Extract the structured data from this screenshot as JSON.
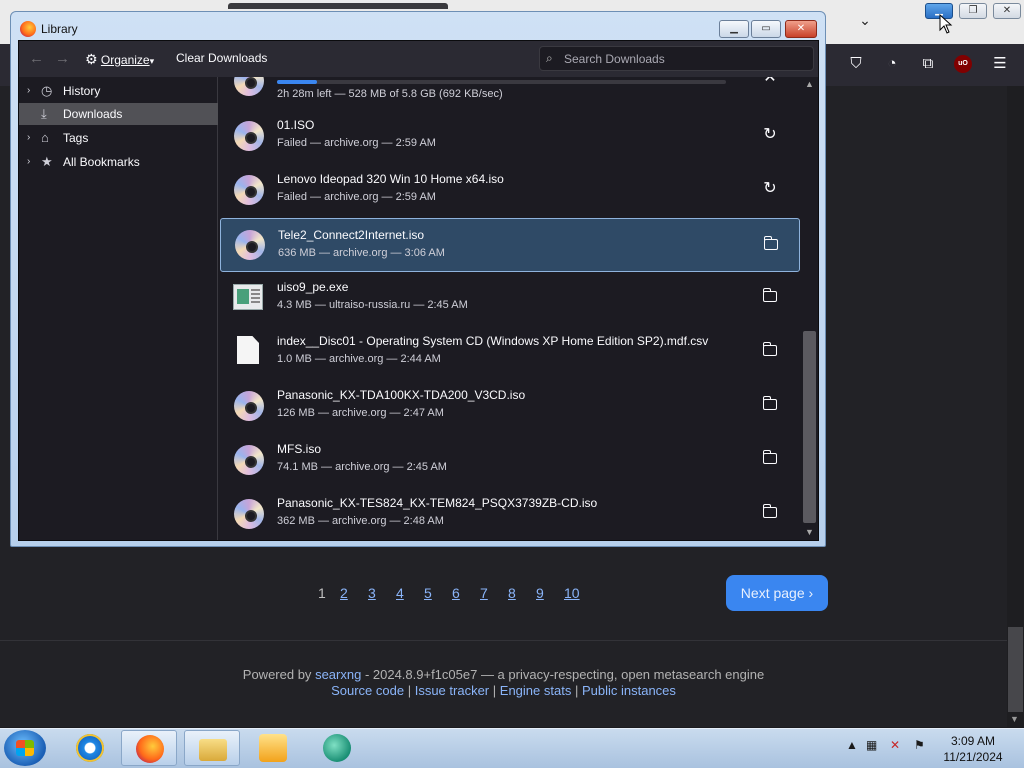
{
  "library": {
    "title": "Library",
    "toolbar": {
      "organize_label": "Organize",
      "organize_caret": "▾",
      "clear_downloads_label": "Clear Downloads",
      "search_placeholder": "Search Downloads"
    },
    "sidebar": [
      {
        "label": "History",
        "icon": "clock-icon"
      },
      {
        "label": "Downloads",
        "icon": "download-icon",
        "selected": true
      },
      {
        "label": "Tags",
        "icon": "tag-icon"
      },
      {
        "label": "All Bookmarks",
        "icon": "star-icon"
      }
    ],
    "downloads": [
      {
        "name": "",
        "status": "2h 28m left — 528 MB of 5.8 GB (692 KB/sec)",
        "icon": "disc-icon",
        "action": "cancel-icon",
        "progress": 0.09
      },
      {
        "name": "01.ISO",
        "status": "Failed — archive.org — 2:59 AM",
        "icon": "disc-icon",
        "action": "retry-icon"
      },
      {
        "name": "Lenovo Ideopad 320 Win 10 Home x64.iso",
        "status": "Failed — archive.org — 2:59 AM",
        "icon": "disc-icon",
        "action": "retry-icon"
      },
      {
        "name": "Tele2_Connect2Internet.iso",
        "status": "636 MB — archive.org — 3:06 AM",
        "icon": "disc-icon",
        "action": "folder-icon",
        "selected": true
      },
      {
        "name": "uiso9_pe.exe",
        "status": "4.3 MB — ultraiso-russia.ru — 2:45 AM",
        "icon": "exe-icon",
        "action": "folder-icon"
      },
      {
        "name": "index__Disc01 - Operating System CD (Windows XP Home Edition SP2).mdf.csv",
        "status": "1.0 MB — archive.org — 2:44 AM",
        "icon": "document-icon",
        "action": "folder-icon"
      },
      {
        "name": "Panasonic_KX-TDA100KX-TDA200_V3CD.iso",
        "status": "126 MB — archive.org — 2:47 AM",
        "icon": "disc-icon",
        "action": "folder-icon"
      },
      {
        "name": "MFS.iso",
        "status": "74.1 MB — archive.org — 2:45 AM",
        "icon": "disc-icon",
        "action": "folder-icon"
      },
      {
        "name": "Panasonic_KX-TES824_KX-TEM824_PSQX3739ZB-CD.iso",
        "status": "362 MB — archive.org — 2:48 AM",
        "icon": "disc-icon",
        "action": "folder-icon"
      }
    ]
  },
  "page": {
    "pagination": {
      "pages": [
        "1",
        "2",
        "3",
        "4",
        "5",
        "6",
        "7",
        "8",
        "9",
        "10"
      ],
      "current": "1"
    },
    "next_page_label": "Next page",
    "next_page_icon": "›",
    "footer": {
      "powered_by": "Powered by",
      "engine_link": "searxng",
      "version_text": "- 2024.8.9+f1c05e7 — a privacy-respecting, open metasearch engine",
      "links": [
        "Source code",
        "Issue tracker",
        "Engine stats",
        "Public instances"
      ],
      "separator": "|"
    }
  },
  "taskbar": {
    "apps": [
      "internet-explorer-icon",
      "firefox-icon",
      "file-explorer-icon",
      "media-player-icon",
      "app-icon"
    ],
    "clock_time": "3:09 AM",
    "clock_date": "11/21/2024"
  },
  "colors": {
    "accent": "#3a86f0",
    "link": "#8ab4f8",
    "selected_row": "#2f4a66"
  }
}
